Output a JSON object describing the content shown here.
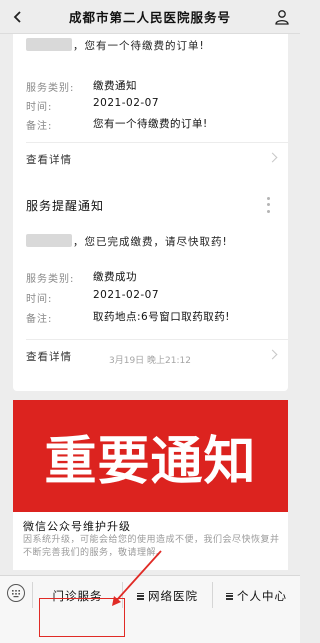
{
  "header": {
    "title": "成都市第二人民医院服务号",
    "back_icon": "chevron-left-icon",
    "profile_icon": "person-icon"
  },
  "cards": [
    {
      "title": "",
      "intro": "，您有一个待缴费的订单!",
      "fields": [
        {
          "label": "服务类别:",
          "value": "缴费通知"
        },
        {
          "label": "时间:",
          "value": "2021-02-07"
        },
        {
          "label": "备注:",
          "value": "您有一个待缴费的订单!"
        }
      ],
      "details_label": "查看详情"
    },
    {
      "title": "服务提醒通知",
      "intro": "，您已完成缴费，请尽快取药!",
      "fields": [
        {
          "label": "服务类别:",
          "value": "缴费成功"
        },
        {
          "label": "时间:",
          "value": "2021-02-07"
        },
        {
          "label": "备注:",
          "value": "取药地点:6号窗口取药取药!"
        }
      ],
      "details_label": "查看详情"
    }
  ],
  "timestamp": "3月19日 晚上21:12",
  "article": {
    "banner_text": "重要通知",
    "title": "微信公众号维护升级",
    "summary": "因系统升级，可能会给您的使用造成不便，我们会尽快恢复并不断完善我们的服务，敬请理解。"
  },
  "menu": {
    "keyboard_icon": "keyboard-icon",
    "items": [
      {
        "label": "门诊服务"
      },
      {
        "label": "网络医院"
      },
      {
        "label": "个人中心"
      }
    ]
  },
  "colors": {
    "banner_red": "#dc231f",
    "highlight_red": "#e02b26",
    "background": "#ededed"
  }
}
